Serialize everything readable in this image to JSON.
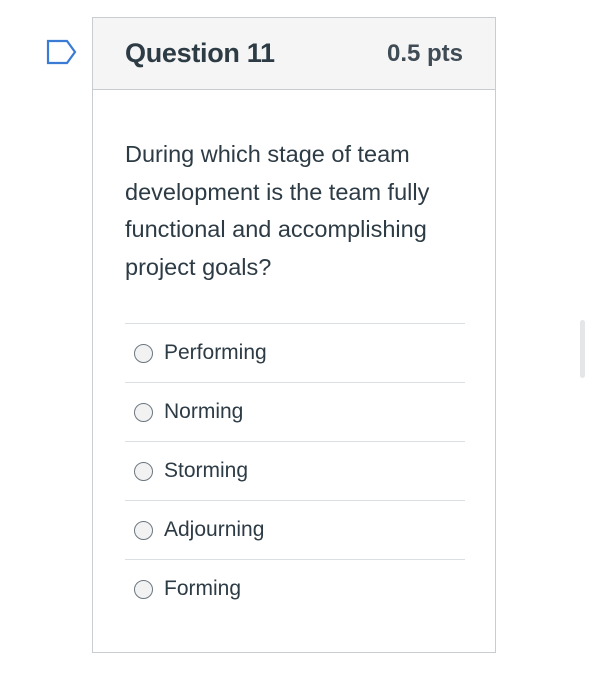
{
  "question": {
    "title": "Question 11",
    "points": "0.5 pts",
    "text": "During which stage of team development is the team fully functional and accomplishing project goals?",
    "answers": [
      {
        "label": "Performing",
        "selected": false
      },
      {
        "label": "Norming",
        "selected": false
      },
      {
        "label": "Storming",
        "selected": false
      },
      {
        "label": "Adjourning",
        "selected": false
      },
      {
        "label": "Forming",
        "selected": false
      }
    ]
  },
  "colors": {
    "flag_outline": "#3a7bd5",
    "header_bg": "#f5f5f5",
    "border": "#c7cdd1",
    "text": "#2d3b45"
  },
  "icons": {
    "flag": "flag-question-icon",
    "radio": "radio-unchecked-icon"
  }
}
